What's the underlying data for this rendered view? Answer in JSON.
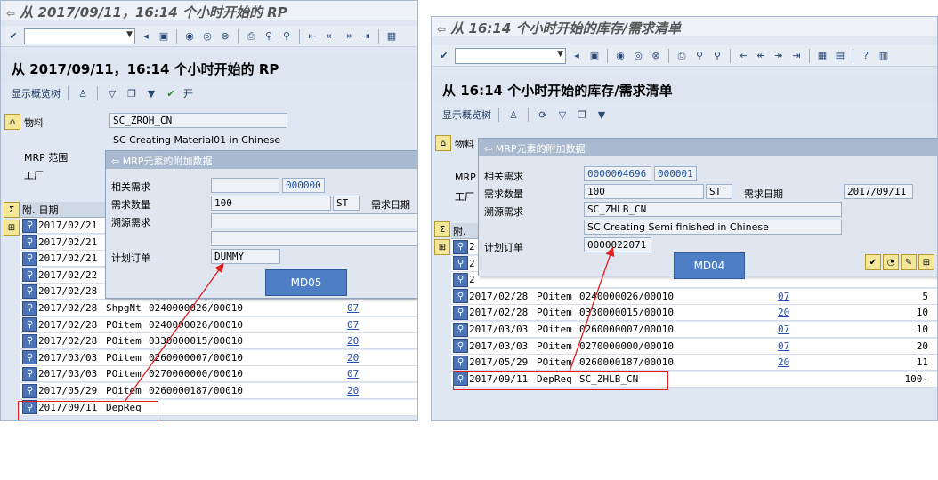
{
  "left": {
    "title": "从 2017/09/11，16:14 个小时开始的 RP",
    "header": "从 2017/09/11，16:14 个小时开始的 RP",
    "apptb": {
      "show_tree": "显示概览树",
      "open": "开"
    },
    "material_label": "物料",
    "material_value": "SC_ZROH_CN",
    "material_desc": "SC Creating Material01 in Chinese",
    "mrp_area_label": "MRP 范围",
    "plant_label": "工厂",
    "grid_header": {
      "col1": "附.",
      "col2": "日期"
    },
    "rows": [
      {
        "date": "2017/02/21",
        "type": "",
        "doc": "",
        "link": ""
      },
      {
        "date": "2017/02/21",
        "type": "",
        "doc": "",
        "link": ""
      },
      {
        "date": "2017/02/21",
        "type": "",
        "doc": "",
        "link": ""
      },
      {
        "date": "2017/02/22",
        "type": "",
        "doc": "",
        "link": ""
      },
      {
        "date": "2017/02/28",
        "type": "",
        "doc": "",
        "link": ""
      },
      {
        "date": "2017/02/28",
        "type": "ShpgNt",
        "doc": "0240000026/00010",
        "link": "07"
      },
      {
        "date": "2017/02/28",
        "type": "POitem",
        "doc": "0240000026/00010",
        "link": "07"
      },
      {
        "date": "2017/02/28",
        "type": "POitem",
        "doc": "0330000015/00010",
        "link": "20"
      },
      {
        "date": "2017/03/03",
        "type": "POitem",
        "doc": "0260000007/00010",
        "link": "20"
      },
      {
        "date": "2017/03/03",
        "type": "POitem",
        "doc": "0270000000/00010",
        "link": "07"
      },
      {
        "date": "2017/05/29",
        "type": "POitem",
        "doc": "0260000187/00010",
        "link": "20"
      },
      {
        "date": "2017/09/11",
        "type": "DepReq",
        "doc": "",
        "link": ""
      }
    ],
    "popup": {
      "title": "MRP元素的附加数据",
      "rel_req_label": "相关需求",
      "rel_req_value2": "000000",
      "req_qty_label": "需求数量",
      "req_qty_value": "100",
      "req_qty_unit": "ST",
      "req_date_label": "需求日期",
      "source_req_label": "溯源需求",
      "plan_order_label": "计划订单",
      "plan_order_value": "DUMMY"
    },
    "callout": "MD05"
  },
  "right": {
    "title": "从 16:14 个小时开始的库存/需求清单",
    "header": "从 16:14 个小时开始的库存/需求清单",
    "apptb": {
      "show_tree": "显示概览树"
    },
    "material_label": "物料",
    "mrp_label": "MRP",
    "plant_label": "工厂",
    "grid_header": {
      "col1": "附."
    },
    "rows_top": [
      {
        "date": "2",
        "type": "",
        "doc": ""
      },
      {
        "date": "2",
        "type": "",
        "doc": ""
      },
      {
        "date": "2",
        "type": "",
        "doc": ""
      }
    ],
    "rows": [
      {
        "date": "2017/02/28",
        "type": "POitem",
        "doc": "0240000026/00010",
        "link": "07",
        "qty": "5"
      },
      {
        "date": "2017/02/28",
        "type": "POitem",
        "doc": "0330000015/00010",
        "link": "20",
        "qty": "10"
      },
      {
        "date": "2017/03/03",
        "type": "POitem",
        "doc": "0260000007/00010",
        "link": "07",
        "qty": "10"
      },
      {
        "date": "2017/03/03",
        "type": "POitem",
        "doc": "0270000000/00010",
        "link": "07",
        "qty": "20"
      },
      {
        "date": "2017/05/29",
        "type": "POitem",
        "doc": "0260000187/00010",
        "link": "20",
        "qty": "11"
      },
      {
        "date": "2017/09/11",
        "type": "DepReq",
        "doc": "SC_ZHLB_CN",
        "link": "",
        "qty": "100-"
      }
    ],
    "popup": {
      "title": "MRP元素的附加数据",
      "rel_req_label": "相关需求",
      "rel_req_value1": "0000004696",
      "rel_req_value2": "000001",
      "req_qty_label": "需求数量",
      "req_qty_value": "100",
      "req_qty_unit": "ST",
      "req_date_label": "需求日期",
      "req_date_value": "2017/09/11",
      "source_req_label": "溯源需求",
      "source_req_value": "SC_ZHLB_CN",
      "source_req_desc": "SC Creating Semi finished in Chinese",
      "plan_order_label": "计划订单",
      "plan_order_value": "0000022071"
    },
    "callout": "MD04"
  },
  "colors": {
    "accent": "#4e7fc6",
    "highlight": "#e02020"
  }
}
